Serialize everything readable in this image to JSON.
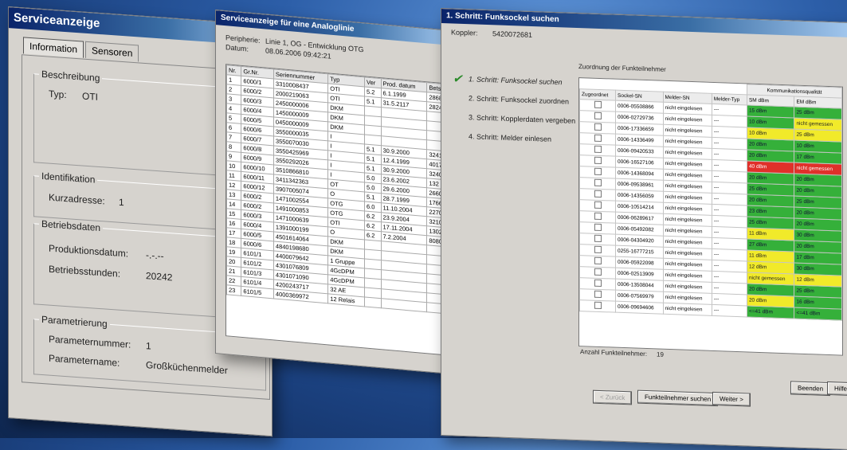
{
  "win1": {
    "title": "Serviceanzeige",
    "tabs": [
      "Information",
      "Sensoren"
    ],
    "beschreibung": {
      "title": "Beschreibung",
      "typ_label": "Typ:",
      "typ_value": "OTI"
    },
    "identifikation": {
      "title": "Identifikation",
      "kurzadresse_label": "Kurzadresse:",
      "kurzadresse_value": "1"
    },
    "betriebsdaten": {
      "title": "Betriebsdaten",
      "produktionsdatum_label": "Produktionsdatum:",
      "produktionsdatum_value": "-.-.--",
      "betriebsstunden_label": "Betriebsstunden:",
      "betriebsstunden_value": "20242"
    },
    "parametrierung": {
      "title": "Parametrierung",
      "parameternummer_label": "Parameternummer:",
      "parameternummer_value": "1",
      "parametername_label": "Parametername:",
      "parametername_value": "Großküchenmelder"
    }
  },
  "win2": {
    "title": "Serviceanzeige für eine Analoglinie",
    "line_label": "Peripherie:",
    "line_value": "Linie 1, OG - Entwicklung OTG",
    "date_label": "Datum:",
    "date_value": "08.06.2006 09:42:21",
    "headers": [
      "Nr.",
      "Gr.Nr.",
      "Seriennummer",
      "Typ",
      "Ver",
      "Prod. datum",
      "Bets."
    ],
    "rows": [
      [
        "1",
        "6000/1",
        "3310008437",
        "OTI",
        "5.2",
        "6.1.1999",
        "28682"
      ],
      [
        "2",
        "6000/2",
        "2000219063",
        "OTI",
        "5.1",
        "31.5.2117",
        "28241"
      ],
      [
        "3",
        "6000/3",
        "2450000006",
        "DKM",
        "",
        "",
        ""
      ],
      [
        "4",
        "6000/4",
        "1450000009",
        "DKM",
        "",
        "",
        ""
      ],
      [
        "5",
        "6000/5",
        "0450000009",
        "DKM",
        "",
        "",
        ""
      ],
      [
        "6",
        "6000/6",
        "3550000035",
        "I",
        "",
        "",
        ""
      ],
      [
        "7",
        "6000/7",
        "3550070030",
        "I",
        "5.1",
        "30.9.2000",
        "32414"
      ],
      [
        "8",
        "6000/8",
        "3550425969",
        "I",
        "5.1",
        "12.4.1999",
        "40173"
      ],
      [
        "9",
        "6000/9",
        "3550292026",
        "I",
        "5.1",
        "30.9.2000",
        "32406"
      ],
      [
        "10",
        "6000/10",
        "3510866810",
        "I",
        "5.0",
        "23.6.2002",
        "132"
      ],
      [
        "11",
        "6000/11",
        "3411342363",
        "OT",
        "5.0",
        "29.6.2000",
        "26602"
      ],
      [
        "12",
        "6000/12",
        "3907005074",
        "O",
        "5.1",
        "28.7.1999",
        "17666"
      ],
      [
        "13",
        "6000/2",
        "1471002554",
        "OTG",
        "6.0",
        "11.10.2004",
        "2270"
      ],
      [
        "14",
        "6000/2",
        "1491000853",
        "OTG",
        "6.2",
        "23.9.2004",
        "3210"
      ],
      [
        "15",
        "6000/3",
        "1471000639",
        "OTI",
        "6.2",
        "17.11.2004",
        "13022"
      ],
      [
        "16",
        "6000/4",
        "1391000199",
        "O",
        "6.2",
        "7.2.2004",
        "8080"
      ],
      [
        "17",
        "6000/5",
        "4501614064",
        "DKM",
        "",
        "",
        ""
      ],
      [
        "18",
        "6000/6",
        "4840198680",
        "DKM",
        "",
        "",
        ""
      ],
      [
        "19",
        "6101/1",
        "4400079642",
        "1 Gruppe",
        "",
        "",
        ""
      ],
      [
        "20",
        "6101/2",
        "4301076809",
        "4GcDPM",
        "",
        "",
        ""
      ],
      [
        "21",
        "6101/3",
        "4301071090",
        "4GcDPM",
        "",
        "",
        ""
      ],
      [
        "22",
        "6101/4",
        "4200243717",
        "32 AE",
        "",
        "",
        ""
      ],
      [
        "23",
        "6101/5",
        "4000369972",
        "12 Relais",
        "",
        "",
        ""
      ]
    ]
  },
  "win3": {
    "title": "1. Schritt: Funksockel suchen",
    "koppler_label": "Koppler:",
    "koppler_value": "5420072681",
    "steps": [
      "1. Schritt: Funksockel suchen",
      "2. Schritt: Funksockel zuordnen",
      "3. Schritt: Kopplerdaten vergeben",
      "4. Schritt: Melder einlesen"
    ],
    "assign_title": "Zuordnung der Funkteilnehmer",
    "quality_header": "Kommunikationsqualität",
    "headers": [
      "Zugeordnet",
      "Sockel-SN",
      "Melder-SN",
      "Melder-Typ",
      "SM dBm",
      "EM dBm"
    ],
    "rows": [
      [
        "0006-05508866",
        "nicht eingelesen",
        "---",
        "15 dBm",
        "25 dBm",
        "g",
        "g"
      ],
      [
        "0006-02729736",
        "nicht eingelesen",
        "---",
        "10 dBm",
        "nicht gemessen",
        "g",
        "y"
      ],
      [
        "0006-17336659",
        "nicht eingelesen",
        "---",
        "10 dBm",
        "25 dBm",
        "y",
        "y"
      ],
      [
        "0006-14336499",
        "nicht eingelesen",
        "---",
        "20 dBm",
        "10 dBm",
        "g",
        "g"
      ],
      [
        "0006-09420533",
        "nicht eingelesen",
        "---",
        "20 dBm",
        "17 dBm",
        "g",
        "g"
      ],
      [
        "0006-16527106",
        "nicht eingelesen",
        "---",
        "40 dBm",
        "nicht gemessen",
        "r",
        "r"
      ],
      [
        "0006-14368094",
        "nicht eingelesen",
        "---",
        "20 dBm",
        "20 dBm",
        "g",
        "g"
      ],
      [
        "0006-09538961",
        "nicht eingelesen",
        "---",
        "25 dBm",
        "20 dBm",
        "g",
        "g"
      ],
      [
        "0006-14356059",
        "nicht eingelesen",
        "---",
        "20 dBm",
        "25 dBm",
        "g",
        "g"
      ],
      [
        "0006-10514214",
        "nicht eingelesen",
        "---",
        "23 dBm",
        "20 dBm",
        "g",
        "g"
      ],
      [
        "0006-06289617",
        "nicht eingelesen",
        "---",
        "25 dBm",
        "20 dBm",
        "g",
        "g"
      ],
      [
        "0006-05492082",
        "nicht eingelesen",
        "---",
        "11 dBm",
        "30 dBm",
        "y",
        "g"
      ],
      [
        "0006-04304920",
        "nicht eingelesen",
        "---",
        "27 dBm",
        "20 dBm",
        "g",
        "g"
      ],
      [
        "0255-16777215",
        "nicht eingelesen",
        "---",
        "11 dBm",
        "17 dBm",
        "y",
        "g"
      ],
      [
        "0006-05922098",
        "nicht eingelesen",
        "---",
        "12 dBm",
        "30 dBm",
        "y",
        "g"
      ],
      [
        "0006-02513909",
        "nicht eingelesen",
        "---",
        "nicht gemessen",
        "12 dBm",
        "y",
        "y"
      ],
      [
        "0006-13508044",
        "nicht eingelesen",
        "---",
        "20 dBm",
        "25 dBm",
        "g",
        "g"
      ],
      [
        "0006-07569979",
        "nicht eingelesen",
        "---",
        "20 dBm",
        "16 dBm",
        "y",
        "g"
      ],
      [
        "0006-09694606",
        "nicht eingelesen",
        "---",
        "<=41 dBm",
        "<=41 dBm",
        "g",
        "g"
      ]
    ],
    "count_label": "Anzahl Funkteilnehmer:",
    "count_value": "19",
    "buttons": {
      "back": "< Zurück",
      "search": "Funkteilnehmer suchen",
      "next": "Weiter >",
      "close": "Beenden",
      "help": "Hilfe"
    }
  },
  "colors": {
    "green": "#35b03a",
    "yellow": "#f1ea2a",
    "red": "#e0302a"
  }
}
